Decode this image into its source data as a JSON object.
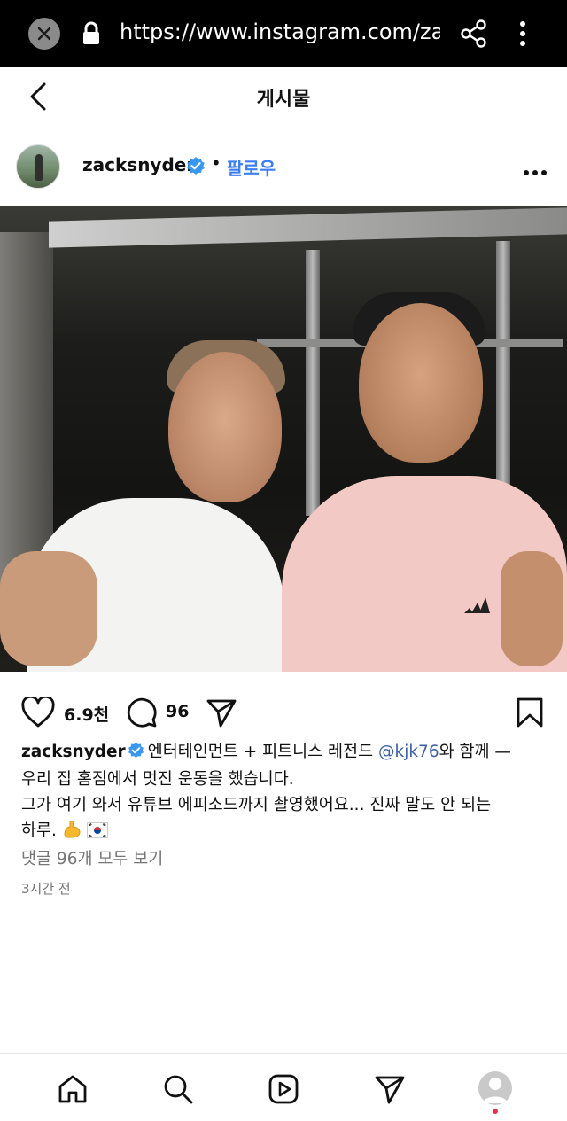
{
  "browser": {
    "url": "https://www.instagram.com/zackl",
    "icons": [
      "close-icon",
      "lock-icon",
      "share-icon",
      "more-vertical-icon"
    ]
  },
  "header": {
    "title": "게시물"
  },
  "post": {
    "username": "zacksnyder",
    "follow_label": "팔로우",
    "separator": "•",
    "likes": "6.9천",
    "comments": "96",
    "caption": {
      "username": "zacksnyder",
      "text_before": "엔터테인먼트 + 피트니스 레전드 ",
      "mention": "@kjk76",
      "text_after": "와 함께 —",
      "line2": "우리 집 홈짐에서 멋진 운동을 했습니다.",
      "line3": "그가 여기 와서 유튜브 에피소드까지 촬영했어요... 진짜 말도 안 되는",
      "line4": "하루."
    },
    "view_comments": "댓글 96개 모두 보기",
    "timestamp": "3시간 전"
  },
  "nav": {
    "items": [
      "home-icon",
      "search-icon",
      "reels-icon",
      "direct-icon",
      "profile-avatar"
    ]
  },
  "colors": {
    "accent": "#3c7ff5",
    "verified": "#3897f0",
    "mention": "#3c5fa8",
    "muted": "#767676"
  }
}
